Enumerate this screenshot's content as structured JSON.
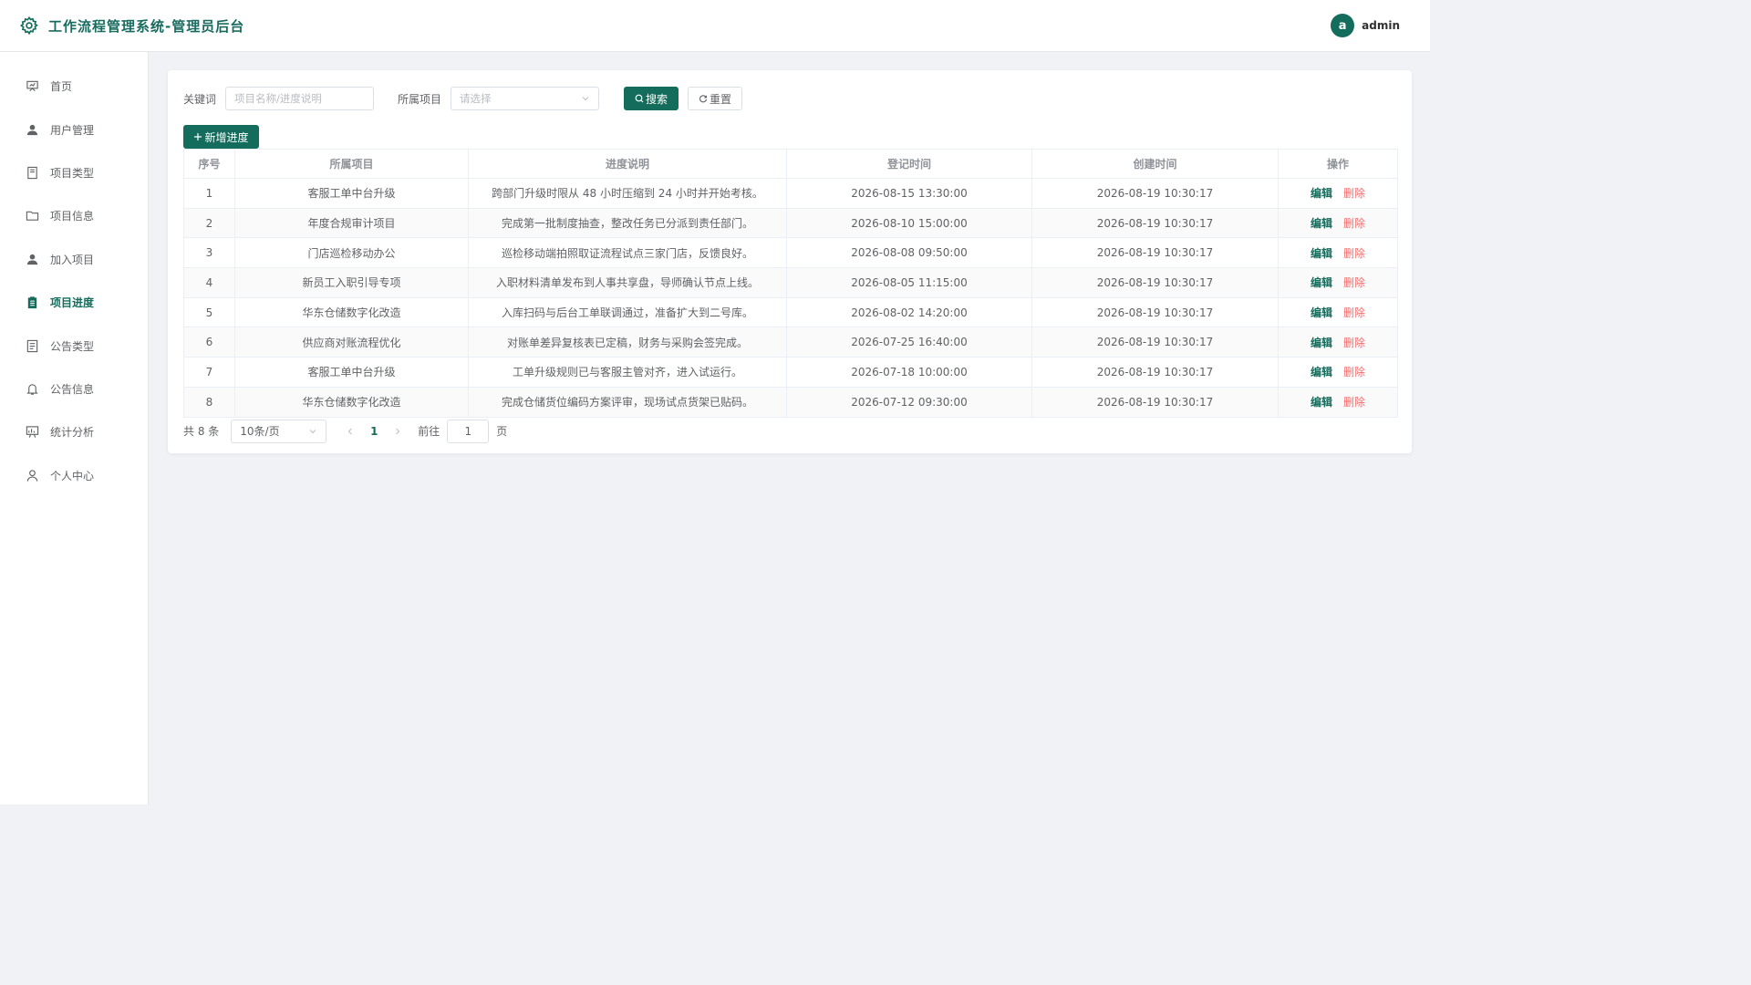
{
  "app": {
    "title": "工作流程管理系统-管理员后台"
  },
  "user": {
    "avatar_letter": "a",
    "name": "admin"
  },
  "colors": {
    "accent": "#146c5c",
    "danger": "#f56c6c"
  },
  "sidebar": {
    "items": [
      {
        "label": "首页",
        "icon": "presentation-icon",
        "active": false
      },
      {
        "label": "用户管理",
        "icon": "user-icon",
        "active": false
      },
      {
        "label": "项目类型",
        "icon": "tablet-icon",
        "active": false
      },
      {
        "label": "项目信息",
        "icon": "folder-icon",
        "active": false
      },
      {
        "label": "加入项目",
        "icon": "user-icon",
        "active": false
      },
      {
        "label": "项目进度",
        "icon": "clipboard-icon",
        "active": true
      },
      {
        "label": "公告类型",
        "icon": "document-icon",
        "active": false
      },
      {
        "label": "公告信息",
        "icon": "bell-icon",
        "active": false
      },
      {
        "label": "统计分析",
        "icon": "chart-board-icon",
        "active": false
      },
      {
        "label": "个人中心",
        "icon": "user-outline-icon",
        "active": false
      }
    ]
  },
  "search": {
    "keyword_label": "关键词",
    "keyword_placeholder": "项目名称/进度说明",
    "project_label": "所属项目",
    "project_placeholder": "请选择",
    "search_button": "搜索",
    "reset_button": "重置"
  },
  "toolbar": {
    "add_button": "新增进度"
  },
  "table": {
    "headers": [
      "序号",
      "所属项目",
      "进度说明",
      "登记时间",
      "创建时间",
      "操作"
    ],
    "edit_label": "编辑",
    "delete_label": "删除",
    "rows": [
      {
        "no": "1",
        "project": "客服工单中台升级",
        "desc": "跨部门升级时限从 48 小时压缩到 24 小时并开始考核。",
        "reg_time": "2026-08-15 13:30:00",
        "created": "2026-08-19 10:30:17"
      },
      {
        "no": "2",
        "project": "年度合规审计项目",
        "desc": "完成第一批制度抽查，整改任务已分派到责任部门。",
        "reg_time": "2026-08-10 15:00:00",
        "created": "2026-08-19 10:30:17"
      },
      {
        "no": "3",
        "project": "门店巡检移动办公",
        "desc": "巡检移动端拍照取证流程试点三家门店，反馈良好。",
        "reg_time": "2026-08-08 09:50:00",
        "created": "2026-08-19 10:30:17"
      },
      {
        "no": "4",
        "project": "新员工入职引导专项",
        "desc": "入职材料清单发布到人事共享盘，导师确认节点上线。",
        "reg_time": "2026-08-05 11:15:00",
        "created": "2026-08-19 10:30:17"
      },
      {
        "no": "5",
        "project": "华东仓储数字化改造",
        "desc": "入库扫码与后台工单联调通过，准备扩大到二号库。",
        "reg_time": "2026-08-02 14:20:00",
        "created": "2026-08-19 10:30:17"
      },
      {
        "no": "6",
        "project": "供应商对账流程优化",
        "desc": "对账单差异复核表已定稿，财务与采购会签完成。",
        "reg_time": "2026-07-25 16:40:00",
        "created": "2026-08-19 10:30:17"
      },
      {
        "no": "7",
        "project": "客服工单中台升级",
        "desc": "工单升级规则已与客服主管对齐，进入试运行。",
        "reg_time": "2026-07-18 10:00:00",
        "created": "2026-08-19 10:30:17"
      },
      {
        "no": "8",
        "project": "华东仓储数字化改造",
        "desc": "完成仓储货位编码方案评审，现场试点货架已贴码。",
        "reg_time": "2026-07-12 09:30:00",
        "created": "2026-08-19 10:30:17"
      }
    ]
  },
  "pagination": {
    "total_text": "共 8 条",
    "page_size": "10条/页",
    "current_page": "1",
    "goto_label": "前往",
    "goto_value": "1",
    "page_suffix": "页"
  }
}
